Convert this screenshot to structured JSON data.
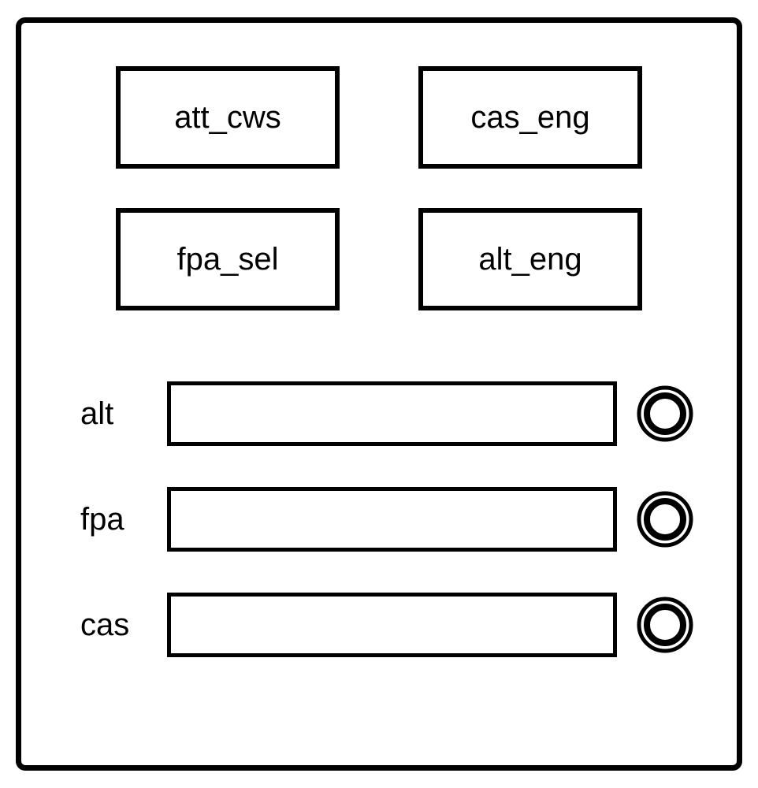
{
  "buttons": {
    "att_cws": "att_cws",
    "cas_eng": "cas_eng",
    "fpa_sel": "fpa_sel",
    "alt_eng": "alt_eng"
  },
  "inputs": {
    "alt": {
      "label": "alt",
      "value": ""
    },
    "fpa": {
      "label": "fpa",
      "value": ""
    },
    "cas": {
      "label": "cas",
      "value": ""
    }
  }
}
